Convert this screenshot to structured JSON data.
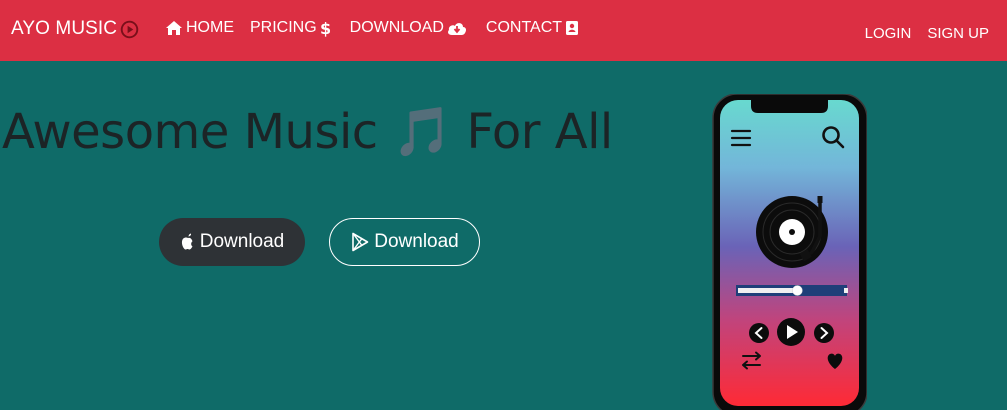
{
  "brand": {
    "name": "AYO MUSIC",
    "icon": "play-circle-icon"
  },
  "nav": {
    "items": [
      {
        "label": "HOME",
        "icon": "home-icon"
      },
      {
        "label": "PRICING",
        "icon": "dollar-icon"
      },
      {
        "label": "DOWNLOAD",
        "icon": "cloud-download-icon"
      },
      {
        "label": "CONTACT",
        "icon": "contact-card-icon"
      }
    ],
    "login": "LOGIN",
    "signup": "SIGN UP"
  },
  "hero": {
    "title_start": "Awesome Music",
    "title_emoji": "🎵",
    "title_end": "For All",
    "apple_button": "Download",
    "play_button": "Download"
  },
  "player": {
    "progress": 0.56
  },
  "colors": {
    "navbar": "#dc2f43",
    "background": "#0f6b68",
    "apple_button": "#2e3236",
    "screen_top": "#68d9cf",
    "screen_mid": "#6a63b7",
    "screen_bottom": "#ff2a35"
  }
}
